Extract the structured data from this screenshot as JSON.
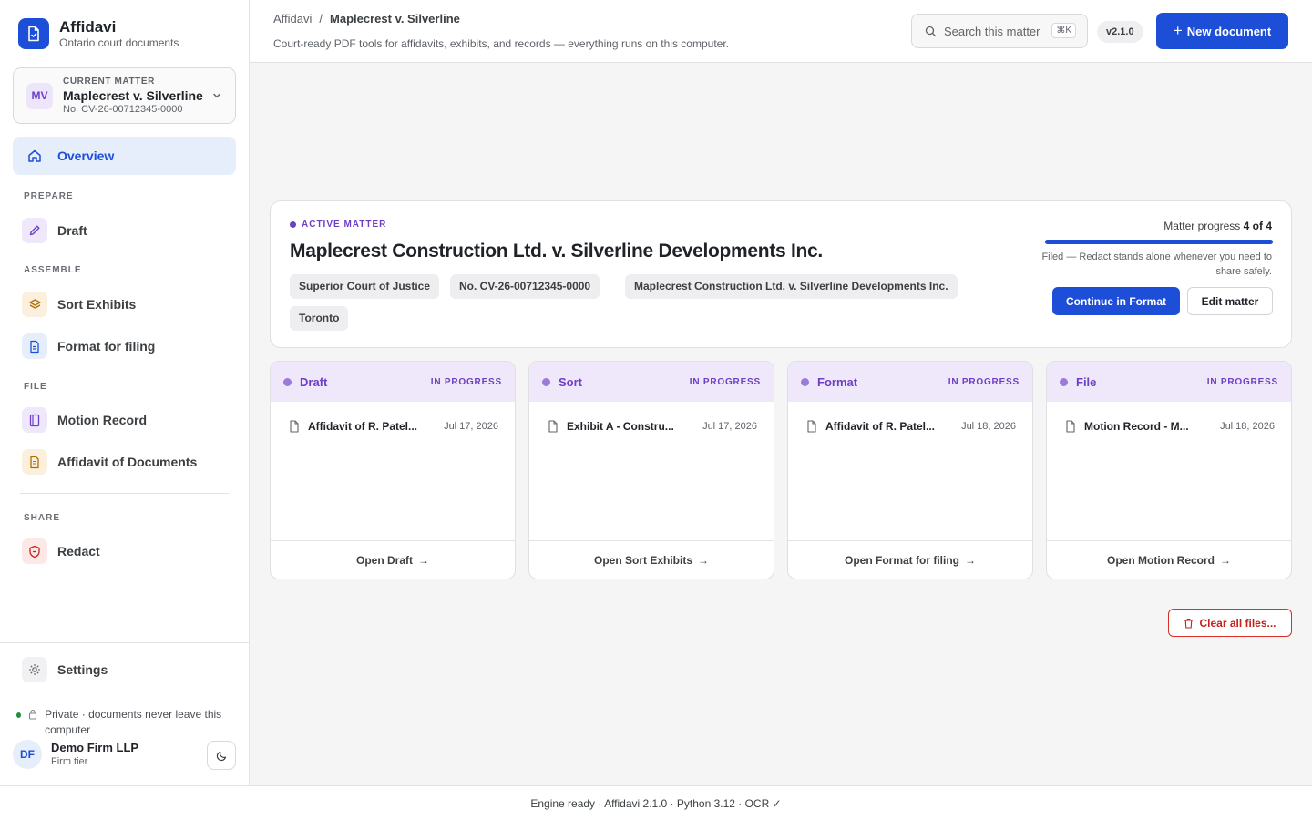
{
  "brand": {
    "name": "Affidavi",
    "subtitle": "Ontario court documents"
  },
  "matter_selector": {
    "initials": "MV",
    "label": "CURRENT MATTER",
    "name": "Maplecrest v. Silverline",
    "number": "No. CV-26-00712345-0000"
  },
  "nav": {
    "overview": "Overview",
    "sections": {
      "prepare": "PREPARE",
      "assemble": "ASSEMBLE",
      "file": "FILE",
      "share": "SHARE"
    },
    "draft": "Draft",
    "sort_exhibits": "Sort Exhibits",
    "format_for_filing": "Format for filing",
    "motion_record": "Motion Record",
    "affidavit_of_documents": "Affidavit of Documents",
    "redact": "Redact",
    "settings": "Settings"
  },
  "privacy_note": "Private · documents never leave this computer",
  "user": {
    "initials": "DF",
    "name": "Demo Firm LLP",
    "tier": "Firm tier"
  },
  "header": {
    "breadcrumb": [
      "Affidavi",
      "/",
      "Maplecrest v. Silverline"
    ],
    "tagline": "Court-ready PDF tools for affidavits, exhibits, and records — everything runs on this computer.",
    "search_placeholder": "Search this matter",
    "search_shortcut": "⌘K",
    "version": "v2.1.0",
    "new_document": "New document"
  },
  "active_matter": {
    "tag": "ACTIVE MATTER",
    "title": "Maplecrest Construction Ltd. v. Silverline Developments Inc.",
    "chips": [
      "Superior Court of Justice",
      "No. CV-26-00712345-0000",
      "Maplecrest Construction Ltd. v. Silverline Developments Inc.",
      "Toronto"
    ],
    "progress_label": "Matter progress",
    "progress_value": "4 of 4",
    "progress_fraction": 1.0,
    "progress_note": "Filed — Redact stands alone whenever you need to share safely.",
    "continue_button": "Continue in Format",
    "edit_button": "Edit matter"
  },
  "stages": [
    {
      "name": "Draft",
      "status": "IN PROGRESS",
      "file": "Affidavit of R. Patel...",
      "date": "Jul 17, 2026",
      "action": "Open Draft"
    },
    {
      "name": "Sort",
      "status": "IN PROGRESS",
      "file": "Exhibit A - Constru...",
      "date": "Jul 17, 2026",
      "action": "Open Sort Exhibits"
    },
    {
      "name": "Format",
      "status": "IN PROGRESS",
      "file": "Affidavit of R. Patel...",
      "date": "Jul 18, 2026",
      "action": "Open Format for filing"
    },
    {
      "name": "File",
      "status": "IN PROGRESS",
      "file": "Motion Record - M...",
      "date": "Jul 18, 2026",
      "action": "Open Motion Record"
    }
  ],
  "clear_files": "Clear all files...",
  "status_bar": "Engine ready · Affidavi 2.1.0 · Python 3.12 · OCR ✓",
  "colors": {
    "accent": "#1d4ed8",
    "purple": "#6d3fc4",
    "danger": "#c5221f",
    "success": "#1e8e3e"
  }
}
